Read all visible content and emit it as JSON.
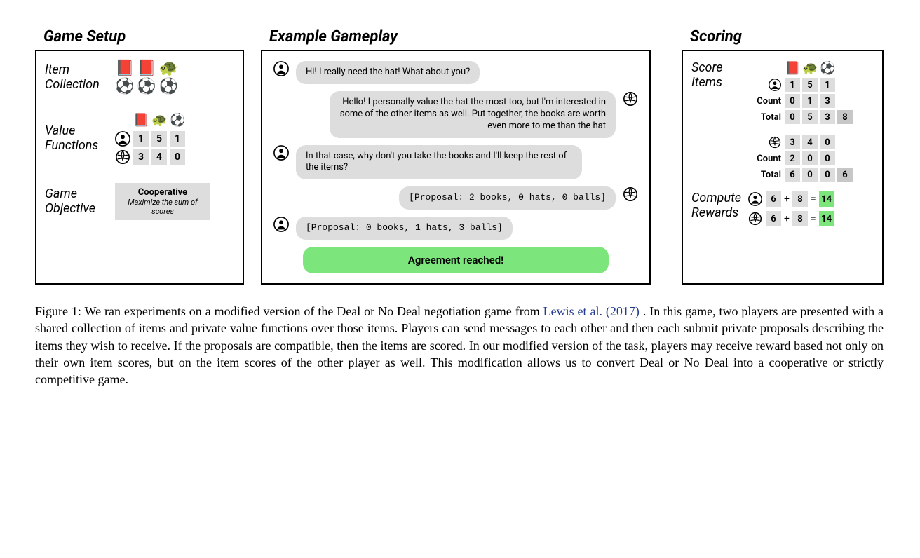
{
  "headings": {
    "setup": "Game Setup",
    "gameplay": "Example Gameplay",
    "scoring": "Scoring"
  },
  "setup": {
    "item_collection_label": "Item\nCollection",
    "items_row1": [
      "📕",
      "📕",
      "🐢"
    ],
    "items_row2": [
      "⚽",
      "⚽",
      "⚽"
    ],
    "value_functions_label": "Value\nFunctions",
    "value_header": [
      "📕",
      "🐢",
      "⚽"
    ],
    "value_human": [
      1,
      5,
      1
    ],
    "value_ai": [
      3,
      4,
      0
    ],
    "game_objective_label": "Game\nObjective",
    "objective_title": "Cooperative",
    "objective_sub": "Maximize the sum of scores"
  },
  "gameplay": {
    "m1": "Hi! I really need the hat! What about you?",
    "m2": "Hello! I personally value the hat the most too, but I'm interested in some of the other items as well. Put together, the books are worth even more to me than the hat",
    "m3": "In that case, why don't you take the books and I'll keep the rest of the items?",
    "m4": "[Proposal: 2 books, 0 hats, 0 balls]",
    "m5": "[Proposal: 0 books, 1 hats, 3 balls]",
    "agree": "Agreement reached!"
  },
  "scoring": {
    "score_items_label": "Score\nItems",
    "header": [
      "📕",
      "🐢",
      "⚽"
    ],
    "human": {
      "vals": [
        1,
        5,
        1
      ],
      "count": [
        0,
        1,
        3
      ],
      "total": [
        0,
        5,
        3
      ],
      "sum": 8
    },
    "ai": {
      "vals": [
        3,
        4,
        0
      ],
      "count": [
        2,
        0,
        0
      ],
      "total": [
        6,
        0,
        0
      ],
      "sum": 6
    },
    "count_label": "Count",
    "total_label": "Total",
    "compute_label": "Compute\nRewards",
    "reward_human": {
      "a": 6,
      "b": 8,
      "sum": 14
    },
    "reward_ai": {
      "a": 6,
      "b": 8,
      "sum": 14
    },
    "plus": "+",
    "eq": "="
  },
  "caption": {
    "prefix": "Figure 1: We ran experiments on a modified version of the Deal or No Deal negotiation game from ",
    "ref": "Lewis et al. (2017)",
    "rest": ". In this game, two players are presented with a shared collection of items and private value functions over those items. Players can send messages to each other and then each submit private proposals describing the items they wish to receive. If the proposals are compatible, then the items are scored. In our modified version of the task, players may receive reward based not only on their own item scores, but on the item scores of the other player as well. This modification allows us to convert Deal or No Deal into a cooperative or strictly competitive game."
  }
}
